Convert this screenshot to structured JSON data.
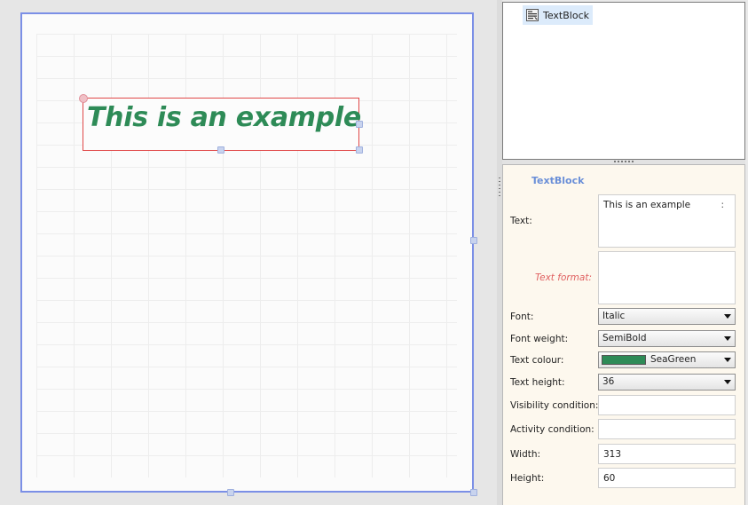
{
  "canvas": {
    "textblock": {
      "text": "This is an example",
      "color": "#2e8b57"
    }
  },
  "tree": {
    "item": {
      "label": "TextBlock",
      "icon": "textblock-icon"
    }
  },
  "properties": {
    "title": "TextBlock",
    "text": {
      "label": "Text:",
      "value": "This is an example",
      "more": ":"
    },
    "text_format": {
      "label": "Text format:",
      "value": ""
    },
    "font": {
      "label": "Font:",
      "value": "Italic"
    },
    "font_weight": {
      "label": "Font weight:",
      "value": "SemiBold"
    },
    "text_colour": {
      "label": "Text colour:",
      "value": "SeaGreen",
      "swatch": "#2e8b57"
    },
    "text_height": {
      "label": "Text height:",
      "value": "36"
    },
    "visibility_condition": {
      "label": "Visibility condition:",
      "value": ""
    },
    "activity_condition": {
      "label": "Activity condition:",
      "value": ""
    },
    "width": {
      "label": "Width:",
      "value": "313"
    },
    "height": {
      "label": "Height:",
      "value": "60"
    }
  }
}
